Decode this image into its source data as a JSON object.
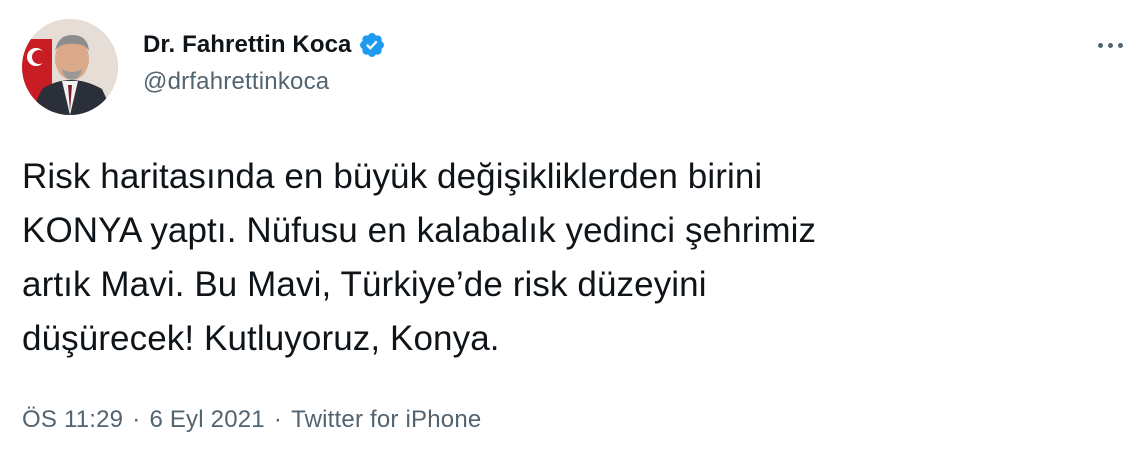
{
  "author": {
    "display_name": "Dr. Fahrettin Koca",
    "handle": "@drfahrettinkoca",
    "verified": true
  },
  "tweet": {
    "text": "Risk haritasında en büyük değişikliklerden birini\nKONYA yaptı. Nüfusu en kalabalık yedinci şehrimiz\nartık Mavi. Bu Mavi, Türkiye’de risk düzeyini\ndüşürecek! Kutluyoruz, Konya.",
    "time": "ÖS 11:29",
    "date": "6 Eyl 2021",
    "source": "Twitter for iPhone",
    "separator": "·"
  },
  "icons": {
    "more": "more-horizontal-icon",
    "verified": "verified-badge-icon"
  },
  "colors": {
    "text_primary": "#0f1419",
    "text_secondary": "#536471",
    "verified_blue": "#1d9bf0"
  }
}
